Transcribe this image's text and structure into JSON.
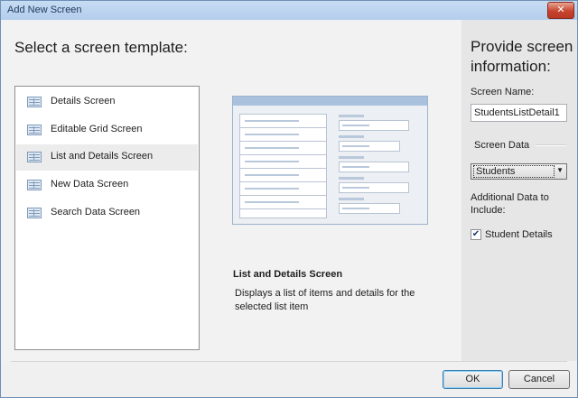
{
  "window": {
    "title": "Add New Screen",
    "close_glyph": "✕"
  },
  "left": {
    "heading": "Select a screen template:",
    "templates": [
      {
        "label": "Details Screen",
        "icon": "details-screen-icon"
      },
      {
        "label": "Editable Grid Screen",
        "icon": "grid-screen-icon"
      },
      {
        "label": "List and Details Screen",
        "icon": "list-details-screen-icon",
        "selected": true
      },
      {
        "label": "New Data Screen",
        "icon": "new-data-screen-icon"
      },
      {
        "label": "Search Data Screen",
        "icon": "search-data-screen-icon"
      }
    ],
    "description": {
      "title": "List and Details Screen",
      "text": "Displays a list of items and details for the selected list item"
    }
  },
  "right": {
    "heading": "Provide screen information:",
    "screen_name_label": "Screen Name:",
    "screen_name_value": "StudentsListDetail1",
    "screen_data_label": "Screen Data",
    "screen_data_selected": "Students",
    "additional_data_label": "Additional Data to Include:",
    "student_details_label": "Student Details",
    "student_details_checked": true
  },
  "footer": {
    "ok_label": "OK",
    "cancel_label": "Cancel"
  },
  "colors": {
    "titlebar": "#b9d1ee",
    "close": "#c7432d",
    "accent": "#3c7fb1"
  }
}
